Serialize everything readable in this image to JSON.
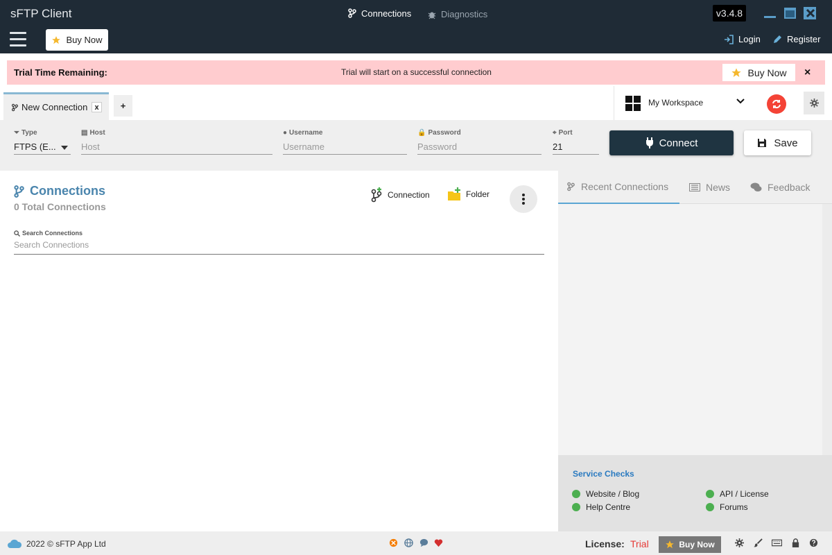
{
  "window": {
    "title": "sFTP Client",
    "version": "v3.4.8",
    "tabs": [
      {
        "label": "Connections",
        "icon": "branch-icon",
        "active": true
      },
      {
        "label": "Diagnostics",
        "icon": "bug-icon",
        "active": false
      }
    ]
  },
  "navbar": {
    "buy_now": "Buy Now",
    "login": "Login",
    "register": "Register"
  },
  "trial": {
    "label": "Trial Time Remaining:",
    "message": "Trial will start on a successful connection",
    "buy_now": "Buy Now",
    "close": "×",
    "background": "#ffcccf"
  },
  "tabstrip": {
    "tab_label": "New Connection",
    "tab_close": "x",
    "add": "+",
    "workspace": "My Workspace"
  },
  "form": {
    "type": {
      "label": "Type",
      "value": "FTPS (E..."
    },
    "host": {
      "label": "Host",
      "placeholder": "Host"
    },
    "username": {
      "label": "Username",
      "placeholder": "Username"
    },
    "password": {
      "label": "Password",
      "placeholder": "Password"
    },
    "port": {
      "label": "Port",
      "value": "21"
    },
    "connect": "Connect",
    "save": "Save"
  },
  "connections": {
    "title": "Connections",
    "count": "0 Total Connections",
    "add_connection": "Connection",
    "add_folder": "Folder",
    "search_label": "Search Connections",
    "search_placeholder": "Search Connections"
  },
  "right_panel": {
    "tabs": [
      {
        "label": "Recent Connections",
        "active": true
      },
      {
        "label": "News",
        "active": false
      },
      {
        "label": "Feedback",
        "active": false
      }
    ],
    "service_checks": {
      "title": "Service Checks",
      "items": [
        "Website / Blog",
        "Help Centre",
        "API / License",
        "Forums"
      ],
      "status_color": "#4caf50"
    }
  },
  "footer": {
    "copyright": "2022 © sFTP App Ltd",
    "license_label": "License:",
    "license_value": "Trial",
    "buy_now": "Buy Now"
  },
  "colors": {
    "titlebar": "#1f2b36",
    "accent": "#4a85ad",
    "connect_button": "#1f3441",
    "sync_button": "#f44336"
  }
}
